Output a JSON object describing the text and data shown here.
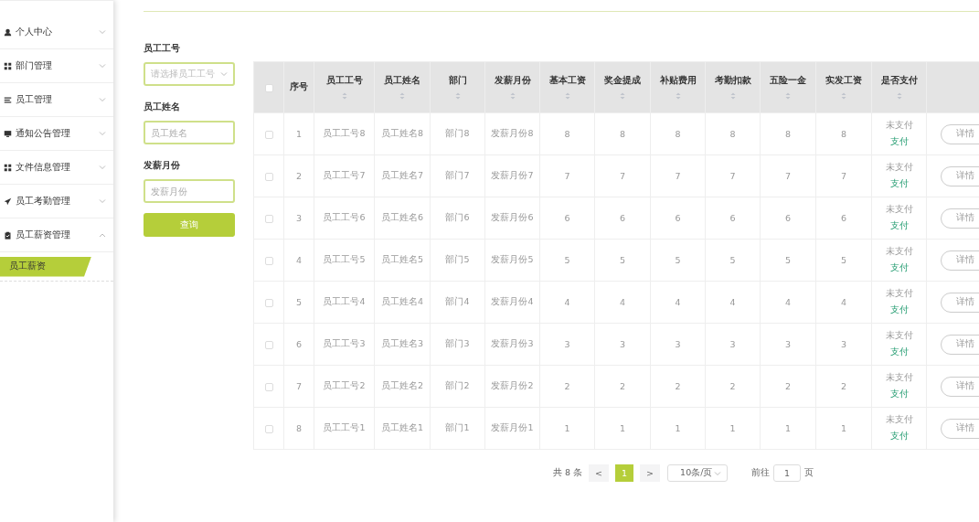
{
  "sidebar": {
    "items": [
      {
        "label": "个人中心",
        "expanded": false
      },
      {
        "label": "部门管理",
        "expanded": false
      },
      {
        "label": "员工管理",
        "expanded": false
      },
      {
        "label": "通知公告管理",
        "expanded": false
      },
      {
        "label": "文件信息管理",
        "expanded": false
      },
      {
        "label": "员工考勤管理",
        "expanded": false
      },
      {
        "label": "员工薪资管理",
        "expanded": true,
        "children": [
          {
            "label": "员工薪资",
            "selected": true
          }
        ]
      }
    ]
  },
  "search_form": {
    "fields": [
      {
        "label": "员工工号",
        "placeholder": "请选择员工工号",
        "kind": "select"
      },
      {
        "label": "员工姓名",
        "placeholder": "员工姓名",
        "kind": "input"
      },
      {
        "label": "发薪月份",
        "placeholder": "发薪月份",
        "kind": "input"
      }
    ],
    "button": "查询"
  },
  "table": {
    "select_all_checked": false,
    "columns": [
      {
        "label": "序号",
        "sortable": false
      },
      {
        "label": "员工工号",
        "sortable": true
      },
      {
        "label": "员工姓名",
        "sortable": true
      },
      {
        "label": "部门",
        "sortable": true
      },
      {
        "label": "发薪月份",
        "sortable": true
      },
      {
        "label": "基本工资",
        "sortable": true
      },
      {
        "label": "奖金提成",
        "sortable": true
      },
      {
        "label": "补贴费用",
        "sortable": true
      },
      {
        "label": "考勤扣款",
        "sortable": true
      },
      {
        "label": "五险一金",
        "sortable": true
      },
      {
        "label": "实发工资",
        "sortable": true
      },
      {
        "label": "是否支付",
        "sortable": true
      }
    ],
    "rows": [
      {
        "checked": false,
        "cells": [
          "1",
          "员工工号8",
          "员工姓名8",
          "部门8",
          "发薪月份8",
          "8",
          "8",
          "8",
          "8",
          "8",
          "8"
        ],
        "status": "未支付",
        "pay_link": "支付",
        "action": "详情"
      },
      {
        "checked": false,
        "cells": [
          "2",
          "员工工号7",
          "员工姓名7",
          "部门7",
          "发薪月份7",
          "7",
          "7",
          "7",
          "7",
          "7",
          "7"
        ],
        "status": "未支付",
        "pay_link": "支付",
        "action": "详情"
      },
      {
        "checked": false,
        "cells": [
          "3",
          "员工工号6",
          "员工姓名6",
          "部门6",
          "发薪月份6",
          "6",
          "6",
          "6",
          "6",
          "6",
          "6"
        ],
        "status": "未支付",
        "pay_link": "支付",
        "action": "详情"
      },
      {
        "checked": false,
        "cells": [
          "4",
          "员工工号5",
          "员工姓名5",
          "部门5",
          "发薪月份5",
          "5",
          "5",
          "5",
          "5",
          "5",
          "5"
        ],
        "status": "未支付",
        "pay_link": "支付",
        "action": "详情"
      },
      {
        "checked": false,
        "cells": [
          "5",
          "员工工号4",
          "员工姓名4",
          "部门4",
          "发薪月份4",
          "4",
          "4",
          "4",
          "4",
          "4",
          "4"
        ],
        "status": "未支付",
        "pay_link": "支付",
        "action": "详情"
      },
      {
        "checked": false,
        "cells": [
          "6",
          "员工工号3",
          "员工姓名3",
          "部门3",
          "发薪月份3",
          "3",
          "3",
          "3",
          "3",
          "3",
          "3"
        ],
        "status": "未支付",
        "pay_link": "支付",
        "action": "详情"
      },
      {
        "checked": false,
        "cells": [
          "7",
          "员工工号2",
          "员工姓名2",
          "部门2",
          "发薪月份2",
          "2",
          "2",
          "2",
          "2",
          "2",
          "2"
        ],
        "status": "未支付",
        "pay_link": "支付",
        "action": "详情"
      },
      {
        "checked": false,
        "cells": [
          "8",
          "员工工号1",
          "员工姓名1",
          "部门1",
          "发薪月份1",
          "1",
          "1",
          "1",
          "1",
          "1",
          "1"
        ],
        "status": "未支付",
        "pay_link": "支付",
        "action": "详情"
      }
    ]
  },
  "pagination": {
    "total": "共 8 条",
    "prev": "<",
    "pages": [
      {
        "label": "1",
        "selected": true
      }
    ],
    "next": ">",
    "page_size": "10条/页",
    "goto_label": "前往",
    "goto_value": "1",
    "goto_suffix": "页"
  }
}
